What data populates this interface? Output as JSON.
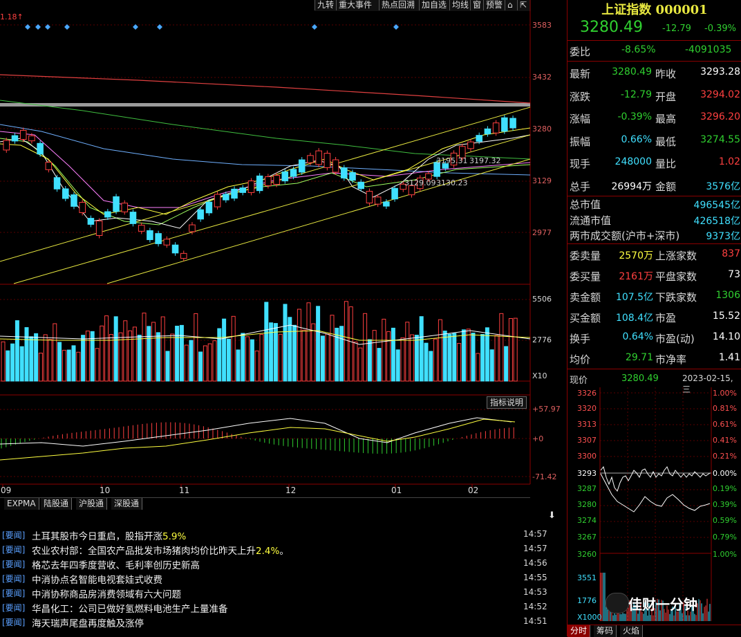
{
  "toolbar": {
    "buttons": [
      "九转",
      "重大事件",
      "热点回溯",
      "加自选",
      "均线",
      "窗",
      "预警"
    ]
  },
  "chart": {
    "peak_label": "1.18↑",
    "price_axis": [
      "3583",
      "3432",
      "3280",
      "3129",
      "2977"
    ],
    "vol_axis": [
      "5506",
      "2776",
      "X10"
    ],
    "macd_axis": [
      "+57.97",
      "+0",
      "-71.42"
    ],
    "indicator_button": "指标说明",
    "month_labels": [
      "09",
      "10",
      "11",
      "12",
      "01",
      "02"
    ],
    "annotations": [
      "3195.31",
      "3197.32",
      "3129.09",
      "3130.23"
    ],
    "bottom_tabs": [
      "EXPMA",
      "陆股通",
      "沪股通",
      "深股通"
    ]
  },
  "news": [
    {
      "tag": "[要闻]",
      "title": "土耳其股市今日重启，股指开涨",
      "hl": "5.9%",
      "tail": "",
      "time": "14:57"
    },
    {
      "tag": "[要闻]",
      "title": "农业农村部：全国农产品批发市场猪肉均价比昨天上升",
      "hl": "2.4%",
      "tail": "。",
      "time": "14:57"
    },
    {
      "tag": "[要闻]",
      "title": "格芯去年四季度营收、毛利率创历史新高",
      "hl": "",
      "tail": "",
      "time": "14:56"
    },
    {
      "tag": "[要闻]",
      "title": "中消协点名智能电视套娃式收费",
      "hl": "",
      "tail": "",
      "time": "14:55"
    },
    {
      "tag": "[要闻]",
      "title": "中消协称商品房消费领域有六大问题",
      "hl": "",
      "tail": "",
      "time": "14:53"
    },
    {
      "tag": "[要闻]",
      "title": "华昌化工：公司已做好氢燃料电池生产上量准备",
      "hl": "",
      "tail": "",
      "time": "14:52"
    },
    {
      "tag": "[要闻]",
      "title": "海天瑞声尾盘再度触及涨停",
      "hl": "",
      "tail": "",
      "time": "14:51"
    }
  ],
  "quote": {
    "name": "上证指数 000001",
    "price": "3280.49",
    "change": "-12.79",
    "pct": "-0.39%",
    "weibi_label": "委比",
    "weibi_pct": "-8.65%",
    "weibi_val": "-4091035",
    "rows": [
      {
        "l1": "最新",
        "v1": "3280.49",
        "c1": "gr",
        "l2": "昨收",
        "v2": "3293.28",
        "c2": "wh"
      },
      {
        "l1": "涨跌",
        "v1": "-12.79",
        "c1": "gr",
        "l2": "开盘",
        "v2": "3294.02",
        "c2": "rd"
      },
      {
        "l1": "涨幅",
        "v1": "-0.39%",
        "c1": "gr",
        "l2": "最高",
        "v2": "3296.20",
        "c2": "rd"
      },
      {
        "l1": "振幅",
        "v1": "0.66%",
        "c1": "cy",
        "l2": "最低",
        "v2": "3274.55",
        "c2": "gr"
      },
      {
        "l1": "现手",
        "v1": "248000",
        "c1": "cy",
        "l2": "量比",
        "v2": "1.02",
        "c2": "rd"
      },
      {
        "l1": "总手",
        "v1": "26994万",
        "c1": "wh",
        "l2": "金额",
        "v2": "3576亿",
        "c2": "cy"
      }
    ],
    "cap_rows": [
      {
        "label": "总市值",
        "value": "496545亿"
      },
      {
        "label": "流通市值",
        "value": "426518亿"
      },
      {
        "label": "两市成交额(沪市+深市)",
        "value": "9373亿"
      }
    ],
    "stat_rows": [
      {
        "l1": "委卖量",
        "v1": "2570万",
        "c1": "yl",
        "l2": "上涨家数",
        "v2": "837",
        "c2": "rd"
      },
      {
        "l1": "委买量",
        "v1": "2161万",
        "c1": "rd",
        "l2": "平盘家数",
        "v2": "73",
        "c2": "wh"
      },
      {
        "l1": "卖金额",
        "v1": "107.5亿",
        "c1": "cy",
        "l2": "下跌家数",
        "v2": "1306",
        "c2": "gr"
      },
      {
        "l1": "买金额",
        "v1": "108.4亿",
        "c1": "cy",
        "l2": "市盈",
        "v2": "15.52",
        "c2": "wh"
      },
      {
        "l1": "换手",
        "v1": "0.64%",
        "c1": "cy",
        "l2": "市盈(动)",
        "v2": "14.10",
        "c2": "wh"
      },
      {
        "l1": "均价",
        "v1": "29.71",
        "c1": "gr",
        "l2": "市净率",
        "v2": "1.41",
        "c2": "wh"
      }
    ],
    "intraday": {
      "label": "现价",
      "price": "3280.49",
      "date": "2023-02-15,三",
      "left_axis": [
        "3326",
        "3320",
        "3313",
        "3307",
        "3300",
        "3293",
        "3287",
        "3280",
        "3274",
        "3267",
        "3260",
        "3551",
        "1776",
        "X1000"
      ],
      "right_axis": [
        "1.00%",
        "0.81%",
        "0.61%",
        "0.41%",
        "0.21%",
        "0.00%",
        "0.19%",
        "0.39%",
        "0.59%",
        "0.79%",
        "1.00%"
      ],
      "tabs": [
        "分时",
        "筹码",
        "火焰"
      ]
    },
    "watermark": "佳财一分钟"
  }
}
